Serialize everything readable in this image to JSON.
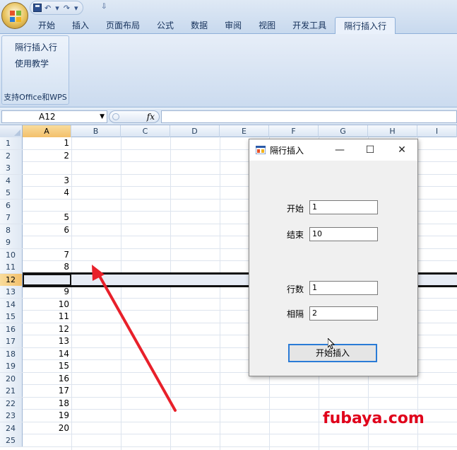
{
  "qat": {
    "undo_symbol": "↶",
    "redo_symbol": "↷",
    "dropdown_symbol": "▾",
    "more_symbol": "⇩"
  },
  "tabs": [
    "开始",
    "插入",
    "页面布局",
    "公式",
    "数据",
    "审阅",
    "视图",
    "开发工具",
    "隔行插入行"
  ],
  "active_tab_index": 8,
  "ribbon": {
    "group_items": [
      "隔行插入行",
      "使用教学"
    ],
    "group_caption": "支持Office和WPS"
  },
  "formula_bar": {
    "name_box": "A12",
    "fx": "fx",
    "value": ""
  },
  "columns": [
    "A",
    "B",
    "C",
    "D",
    "E",
    "F",
    "G",
    "H",
    "I"
  ],
  "rows": [
    {
      "n": "1",
      "a": "1"
    },
    {
      "n": "2",
      "a": "2"
    },
    {
      "n": "3",
      "a": ""
    },
    {
      "n": "4",
      "a": "3"
    },
    {
      "n": "5",
      "a": "4"
    },
    {
      "n": "6",
      "a": ""
    },
    {
      "n": "7",
      "a": "5"
    },
    {
      "n": "8",
      "a": "6"
    },
    {
      "n": "9",
      "a": ""
    },
    {
      "n": "10",
      "a": "7"
    },
    {
      "n": "11",
      "a": "8"
    },
    {
      "n": "12",
      "a": ""
    },
    {
      "n": "13",
      "a": "9"
    },
    {
      "n": "14",
      "a": "10"
    },
    {
      "n": "15",
      "a": "11"
    },
    {
      "n": "16",
      "a": "12"
    },
    {
      "n": "17",
      "a": "13"
    },
    {
      "n": "18",
      "a": "14"
    },
    {
      "n": "19",
      "a": "15"
    },
    {
      "n": "20",
      "a": "16"
    },
    {
      "n": "21",
      "a": "17"
    },
    {
      "n": "22",
      "a": "18"
    },
    {
      "n": "23",
      "a": "19"
    },
    {
      "n": "24",
      "a": "20"
    },
    {
      "n": "25",
      "a": ""
    }
  ],
  "selected_row": "12",
  "dialog": {
    "title": "隔行插入",
    "minimize": "—",
    "maximize": "☐",
    "close": "✕",
    "start_label": "开始",
    "start_value": "1",
    "end_label": "结束",
    "end_value": "10",
    "rows_label": "行数",
    "rows_value": "1",
    "interval_label": "相隔",
    "interval_value": "2",
    "run_button": "开始插入"
  },
  "watermark": "fubaya.com",
  "colors": {
    "accent_blue": "#2a7bd6",
    "selection": "#f3c06b",
    "arrow": "#e8202a",
    "watermark": "#e0001a"
  }
}
